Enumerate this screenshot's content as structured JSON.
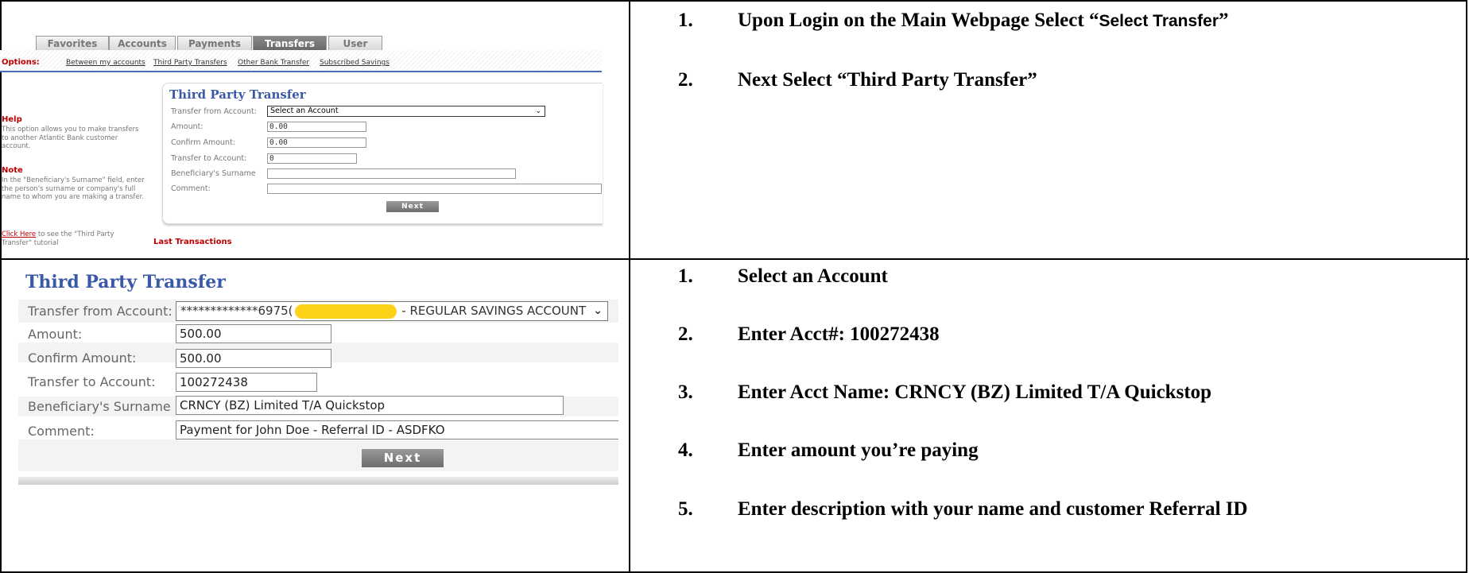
{
  "small_ui": {
    "tabs": [
      "Favorites",
      "Accounts",
      "Payments",
      "Transfers",
      "User"
    ],
    "options_label": "Options:",
    "option_links": [
      "Between my accounts",
      "Third Party Transfers",
      "Other Bank Transfer",
      "Subscribed Savings"
    ],
    "help_title": "Help",
    "help_text": "This option allows you to make transfers to another Atlantic Bank customer account.",
    "note_title": "Note",
    "note_text": "In the \"Beneficiary's Surname\" field, enter the person's surname or company's full name to whom you are making a transfer.",
    "click_here": "Click Here",
    "click_here_rest": " to see the \"Third Party Transfer\" tutorial",
    "form_title": "Third Party Transfer",
    "labels": [
      "Transfer from Account:",
      "Amount:",
      "Confirm Amount:",
      "Transfer to Account:",
      "Beneficiary's Surname",
      "Comment:"
    ],
    "select_value": "Select an Account",
    "amount": "0.00",
    "confirm_amount": "0.00",
    "to_account": "0",
    "surname": "",
    "comment": "",
    "next": "Next",
    "last_transactions": "Last Transactions"
  },
  "big_ui": {
    "form_title": "Third Party Transfer",
    "labels": [
      "Transfer from Account:",
      "Amount:",
      "Confirm Amount:",
      "Transfer to Account:",
      "Beneficiary's Surname",
      "Comment:"
    ],
    "select_prefix": "*************6975(",
    "select_suffix": " - REGULAR SAVINGS ACCOUNT",
    "amount": "500.00",
    "confirm_amount": "500.00",
    "to_account": "100272438",
    "surname": "CRNCY (BZ) Limited T/A Quickstop",
    "comment": "Payment for John Doe - Referral ID - ASDFKO",
    "next": "Next"
  },
  "steps_top": [
    {
      "num": "1.",
      "text_a": "Upon Login on the Main Webpage Select “",
      "text_b": "Select Transfer",
      "text_c": "”"
    },
    {
      "num": "2.",
      "text": "Next Select “Third Party Transfer”"
    }
  ],
  "steps_bottom": [
    {
      "num": "1.",
      "text": "Select an Account"
    },
    {
      "num": "2.",
      "text": "Enter Acct#: 100272438"
    },
    {
      "num": "3.",
      "text": "Enter Acct Name: CRNCY (BZ) Limited T/A Quickstop"
    },
    {
      "num": "4.",
      "text": "Enter amount you’re paying"
    },
    {
      "num": "5.",
      "text": "Enter description with your name and customer Referral ID"
    }
  ],
  "colors": {
    "accent_blue": "#3a5aa8",
    "help_red": "#c00000",
    "redaction": "#ffd21a"
  }
}
